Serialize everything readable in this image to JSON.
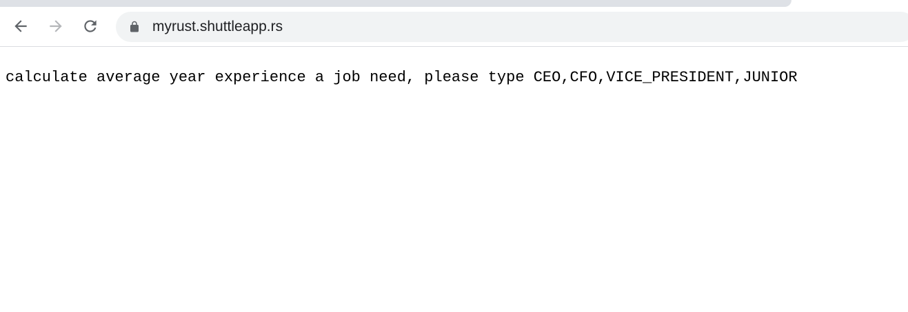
{
  "browser": {
    "address_bar": {
      "url": "myrust.shuttleapp.rs",
      "secure_icon": "lock-icon"
    },
    "nav": {
      "back_icon": "arrow-left-icon",
      "forward_icon": "arrow-right-icon",
      "reload_icon": "reload-icon"
    },
    "colors": {
      "tabstrip": "#dee1e6",
      "omnibox": "#f1f3f4",
      "icon_active": "#5f6368",
      "icon_disabled": "#b4b6b9"
    }
  },
  "page": {
    "text": "calculate average year experience a job need, please type CEO,CFO,VICE_PRESIDENT,JUNIOR"
  }
}
